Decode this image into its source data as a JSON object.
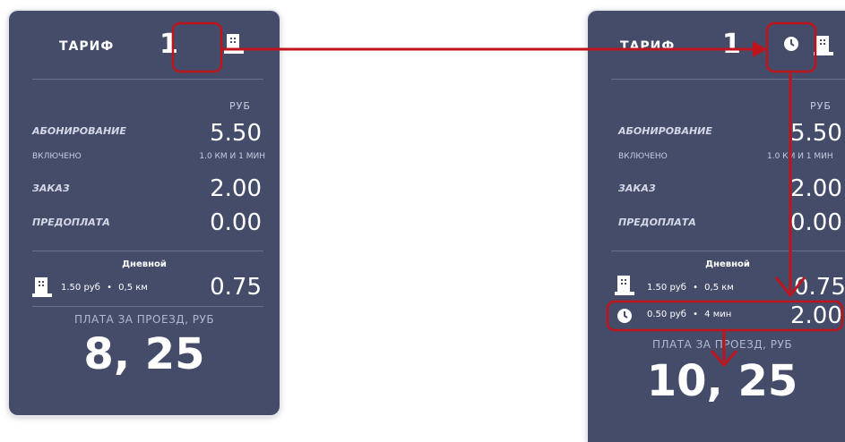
{
  "left_panel": {
    "header": {
      "title": "ТАРИФ",
      "number": "1"
    },
    "currency": "РУБ",
    "subscription": {
      "label": "АБОНИРОВАНИЕ",
      "value": "5.50",
      "included_label": "ВКЛЮЧЕНО",
      "included_value": "1.0 КМ И 1 МИН"
    },
    "order": {
      "label": "ЗАКАЗ",
      "value": "2.00"
    },
    "prepayment": {
      "label": "ПРЕДОПЛАТА",
      "value": "0.00"
    },
    "mode": "Дневной",
    "distance_rate": {
      "price": "1.50 руб",
      "unit": "0,5 км",
      "value": "0.75"
    },
    "total_caption": "ПЛАТА ЗА ПРОЕЗД, РУБ",
    "total": "8, 25"
  },
  "right_panel": {
    "header": {
      "title": "ТАРИФ",
      "number": "1"
    },
    "currency": "РУБ",
    "subscription": {
      "label": "АБОНИРОВАНИЕ",
      "value": "5.50",
      "included_label": "ВКЛЮЧЕНО",
      "included_value": "1.0 КМ И 1 МИН"
    },
    "order": {
      "label": "ЗАКАЗ",
      "value": "2.00"
    },
    "prepayment": {
      "label": "ПРЕДОПЛАТА",
      "value": "0.00"
    },
    "mode": "Дневной",
    "distance_rate": {
      "price": "1.50 руб",
      "unit": "0,5 км",
      "value": "0.75"
    },
    "time_rate": {
      "price": "0.50 руб",
      "unit": "4 мин",
      "value": "2.00"
    },
    "total_caption": "ПЛАТА ЗА ПРОЕЗД, РУБ",
    "total": "10, 25"
  },
  "separator": "•",
  "icons": [
    "building-icon",
    "clock-icon"
  ],
  "colors": {
    "panel_bg": "#444c6a",
    "annotation": "#c0141c",
    "text": "#ffffff",
    "muted": "#c9cce0"
  }
}
